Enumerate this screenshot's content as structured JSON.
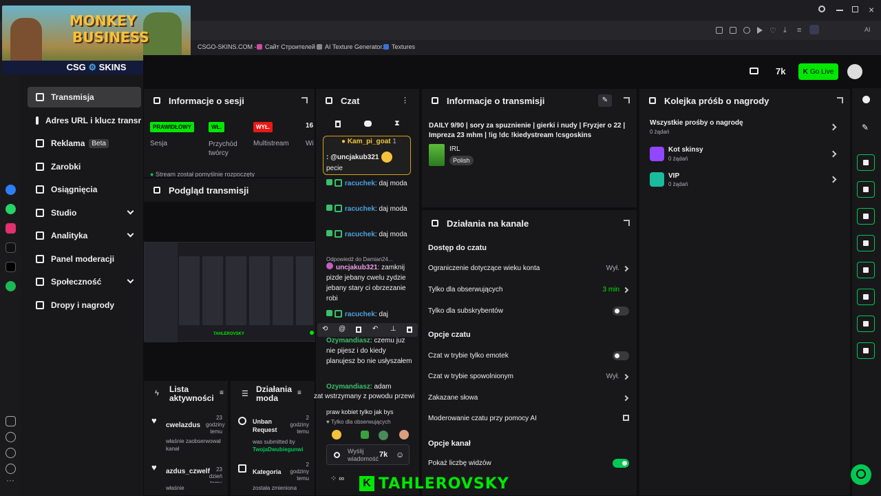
{
  "overlay": {
    "game_title_line1": "MONKEY",
    "game_title_line2": "BUSINESS",
    "sponsor": "CSG",
    "sponsor2": "SKINS"
  },
  "bookmarks": [
    {
      "label": "CSGO-SKINS.COM -..."
    },
    {
      "label": "Сайт Строителей"
    },
    {
      "label": "AI Texture Generator..."
    },
    {
      "label": "Textures"
    }
  ],
  "header": {
    "go_live": "Go Live"
  },
  "sidebar": {
    "items": [
      {
        "label": "Transmisja"
      },
      {
        "label": "Adres URL i klucz transmisji"
      },
      {
        "label": "Reklama",
        "badge": "Beta"
      },
      {
        "label": "Zarobki"
      },
      {
        "label": "Osiągnięcia"
      },
      {
        "label": "Studio"
      },
      {
        "label": "Analityka"
      },
      {
        "label": "Panel moderacji"
      },
      {
        "label": "Społeczność"
      },
      {
        "label": "Dropy i nagrody"
      }
    ]
  },
  "session": {
    "title": "Informacje o sesji",
    "badge1": "PRAWIDŁOWY",
    "label1": "Sesja",
    "badge2": "WŁ.",
    "label2": "Przychód twórcy",
    "badge3": "WYŁ.",
    "label3": "Multistream",
    "value4": "16",
    "label4": "Wi",
    "status": "Stream został pomyślnie rozpoczęty"
  },
  "preview": {
    "title": "Podgląd transmisji",
    "watermark": "TAHLEROVSKY"
  },
  "activity": {
    "title": "Lista aktywności",
    "items": [
      {
        "user": "cwelazdus",
        "time": "23 godziny temu",
        "desc": "właśnie zaobserwował kanał"
      },
      {
        "user": "azdus_czwelf",
        "time": "23 dzień temu",
        "desc": "właśnie"
      }
    ]
  },
  "mod_actions": {
    "title": "Działania moda",
    "items": [
      {
        "title": "Unban Request",
        "time": "2 godziny temu",
        "desc": "was submitted by",
        "user": "TwojaDwubiegunwi"
      },
      {
        "title": "Kategoria",
        "time": "2 godziny temu",
        "desc": "została zmieniona"
      }
    ]
  },
  "chat": {
    "title": "Czat",
    "pinned_user": "Kam_pi_goat",
    "pinned_count": "1",
    "pinned_text": ": @uncjakub321",
    "pinned_text2": "pecie",
    "messages": [
      {
        "user": "racuchek",
        "text": ": daj moda"
      },
      {
        "user": "racuchek",
        "text": ": daj moda"
      },
      {
        "user": "racuchek",
        "text": ": daj moda"
      },
      {
        "reply": "Odpowiedź do Damian24...",
        "user": "uncjakub321",
        "text": ": zamknij pizde jebany cwelu zydzie jebany stary ci obrzezanie robi"
      },
      {
        "user": "racuchek",
        "text": ": daj"
      },
      {
        "user": "Ozymandiasz",
        "text": ": czemu juz nie pijesz i do kiedy planujesz bo nie usłyszałem"
      },
      {
        "user": "Ozymandiasz",
        "text": ": adam"
      }
    ],
    "overflow_text": "zat wstrzymany z powodu przewi",
    "overflow_text2": "praw kobiet tylko jak bys",
    "followers_only": "Tylko dla obserwujących",
    "input_placeholder": "Wyślij wiadomość"
  },
  "stream_info": {
    "title": "Informacje o transmisji",
    "stream_title": "DAILY 9/90 | sory za spuznienie | gierki i nudy | Fryzjer o 22 | Impreza 23 mhm | !ig !dc !kiedystream !csgoskins",
    "category": "IRL",
    "tag": "Polish"
  },
  "channel_actions": {
    "title": "Działania na kanale",
    "sec1": "Dostęp do czatu",
    "r1": "Ograniczenie dotyczące wieku konta",
    "r1v": "Wył.",
    "r2": "Tylko dla obserwujących",
    "r2v": "3 min",
    "r3": "Tylko dla subskrybentów",
    "sec2": "Opcje czatu",
    "r4": "Czat w trybie tylko emotek",
    "r5": "Czat w trybie spowolnionym",
    "r5v": "Wył.",
    "r6": "Zakazane słowa",
    "r7": "Moderowanie czatu przy pomocy AI",
    "sec3": "Opcje kanał",
    "r8": "Pokaż liczbę widzów"
  },
  "rewards": {
    "title": "Kolejka próśb o nagrody",
    "all": "Wszystkie prośby o nagrodę",
    "all_count": "0 żądań",
    "items": [
      {
        "name": "Kot skinsy",
        "count": "0 żądań"
      },
      {
        "name": "VIP",
        "count": "0 żądań"
      }
    ]
  },
  "colors": {
    "accent": "#00c853",
    "purple": "#9147ff",
    "username_green": "#38c06a",
    "username_blue": "#4aa3df"
  }
}
